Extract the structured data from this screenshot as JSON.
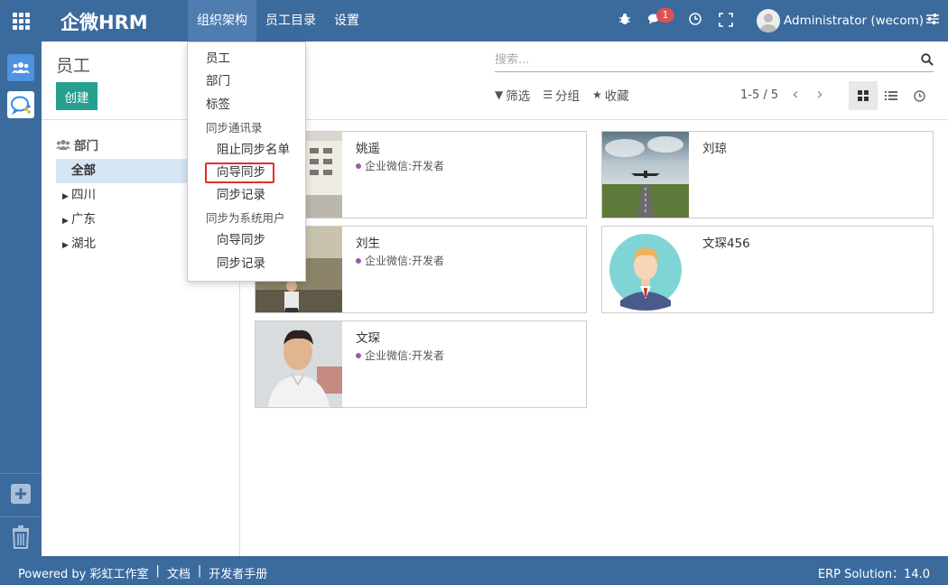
{
  "app": {
    "brand": "企微HRM"
  },
  "topmenu": {
    "items": [
      "组织架构",
      "员工目录",
      "设置"
    ]
  },
  "systray": {
    "message_count": "1",
    "user_name": "Administrator (wecom)"
  },
  "control_panel": {
    "title": "员工",
    "create_label": "创建",
    "search_placeholder": "搜索...",
    "filter_label": "筛选",
    "group_label": "分组",
    "favorite_label": "收藏",
    "pager": "1-5 / 5"
  },
  "departments": {
    "header": "部门",
    "items": [
      {
        "label": "全部",
        "selected": true
      },
      {
        "label": "四川",
        "selected": false
      },
      {
        "label": "广东",
        "selected": false
      },
      {
        "label": "湖北",
        "selected": false
      }
    ]
  },
  "dropdown": {
    "items": [
      "员工",
      "部门",
      "标签"
    ],
    "section_sync_contacts": "同步通讯录",
    "sync_contacts_items": [
      "阻止同步名单",
      "向导同步",
      "同步记录"
    ],
    "section_sync_users": "同步为系统用户",
    "sync_users_items": [
      "向导同步",
      "同步记录"
    ]
  },
  "employees": [
    {
      "name": "姚遥",
      "tag": "企业微信:开发者"
    },
    {
      "name": "刘琼",
      "tag": ""
    },
    {
      "name": "刘生",
      "tag": "企业微信:开发者"
    },
    {
      "name": "文琛456",
      "tag": ""
    },
    {
      "name": "文琛",
      "tag": "企业微信:开发者"
    }
  ],
  "footer": {
    "powered_by": "Powered by 彩虹工作室",
    "sep": "|",
    "docs": "文档",
    "dev_manual": "开发者手册",
    "version": "ERP Solution：14.0"
  },
  "colors": {
    "navbar": "#3b6a9d",
    "primary_button": "#25a08e",
    "badge": "#d9534f",
    "tag_dot": "#9a59b5"
  }
}
